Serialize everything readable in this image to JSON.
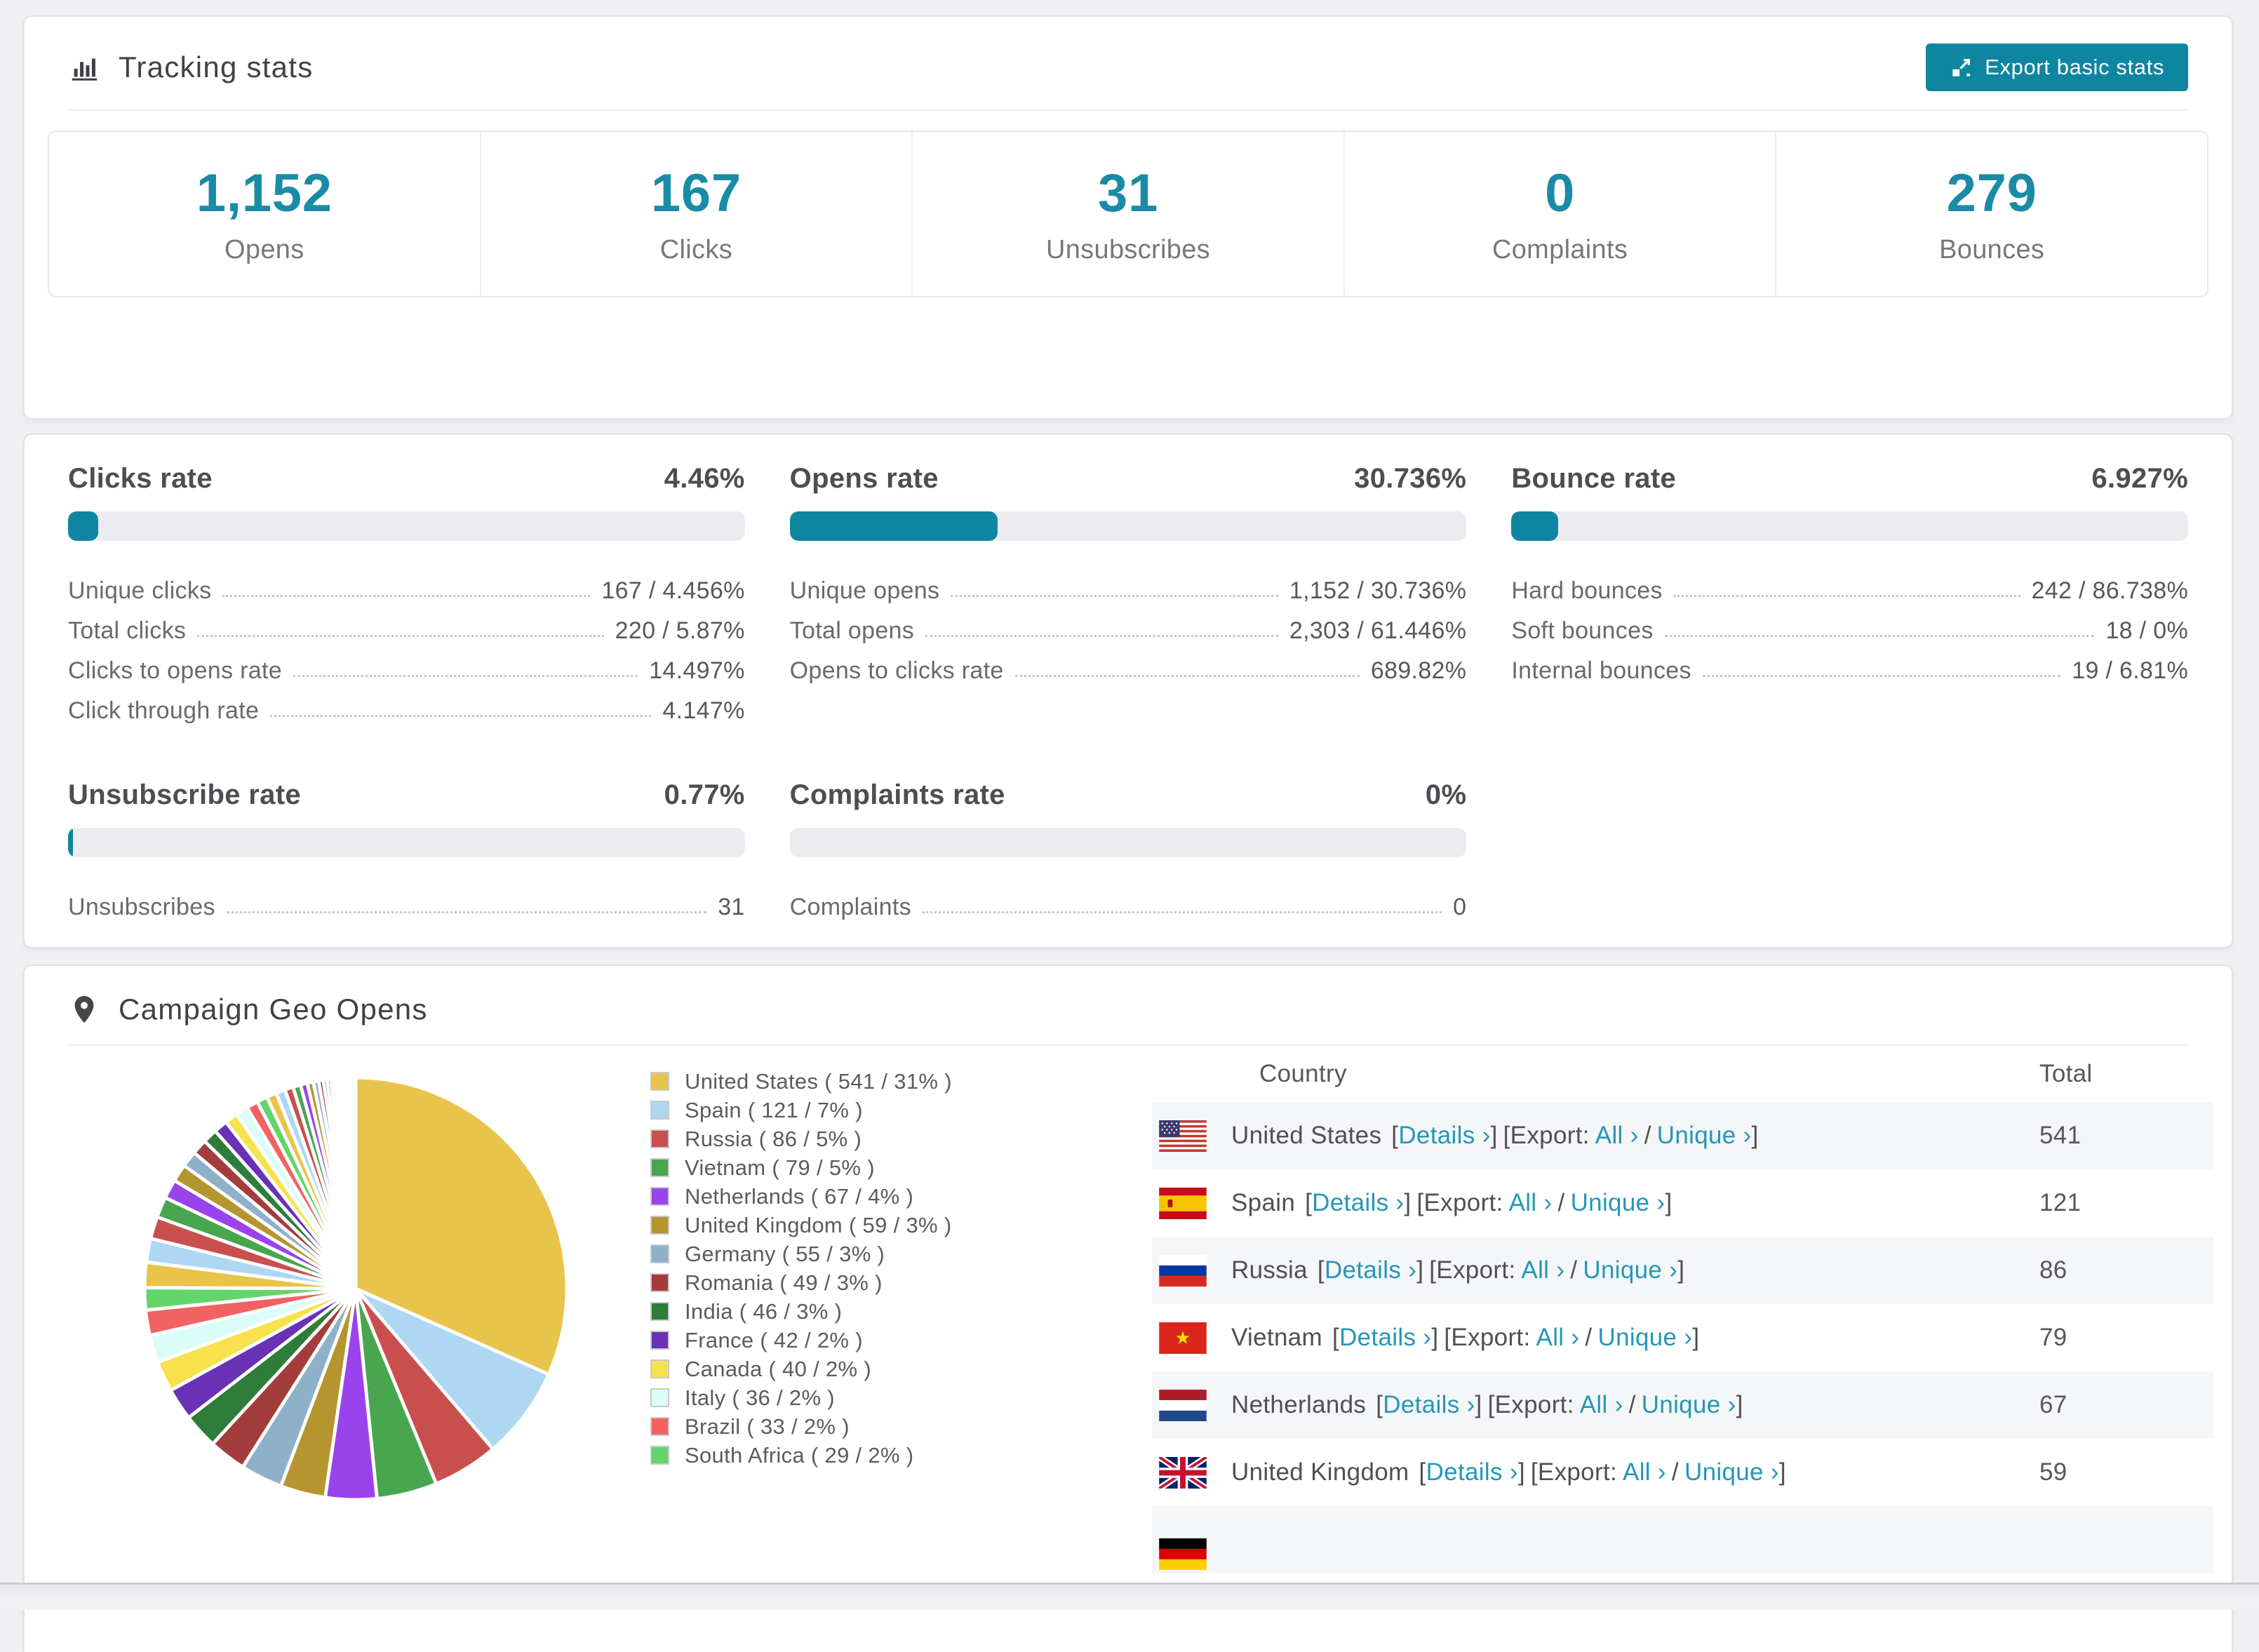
{
  "colors": {
    "accent": "#0e86a1",
    "stat_number": "#1a8ba6",
    "link": "#2497b6",
    "bar_track": "#ececf0",
    "row_alt_bg": "#f5f6f8"
  },
  "tracking": {
    "title": "Tracking stats",
    "export_button": "Export basic stats",
    "stats": [
      {
        "value": "1,152",
        "label": "Opens"
      },
      {
        "value": "167",
        "label": "Clicks"
      },
      {
        "value": "31",
        "label": "Unsubscribes"
      },
      {
        "value": "0",
        "label": "Complaints"
      },
      {
        "value": "279",
        "label": "Bounces"
      }
    ]
  },
  "rates": {
    "clicks": {
      "title": "Clicks rate",
      "value": "4.46%",
      "percent": 4.46,
      "rows": [
        {
          "label": "Unique clicks",
          "value": "167 / 4.456%"
        },
        {
          "label": "Total clicks",
          "value": "220 / 5.87%"
        },
        {
          "label": "Clicks to opens rate",
          "value": "14.497%"
        },
        {
          "label": "Click through rate",
          "value": "4.147%"
        }
      ]
    },
    "opens": {
      "title": "Opens rate",
      "value": "30.736%",
      "percent": 30.736,
      "rows": [
        {
          "label": "Unique opens",
          "value": "1,152 / 30.736%"
        },
        {
          "label": "Total opens",
          "value": "2,303 / 61.446%"
        },
        {
          "label": "Opens to clicks rate",
          "value": "689.82%"
        }
      ]
    },
    "bounce": {
      "title": "Bounce rate",
      "value": "6.927%",
      "percent": 6.927,
      "rows": [
        {
          "label": "Hard bounces",
          "value": "242 / 86.738%"
        },
        {
          "label": "Soft bounces",
          "value": "18 / 0%"
        },
        {
          "label": "Internal bounces",
          "value": "19 / 6.81%"
        }
      ]
    },
    "unsubscribe": {
      "title": "Unsubscribe rate",
      "value": "0.77%",
      "percent": 0.77,
      "rows": [
        {
          "label": "Unsubscribes",
          "value": "31"
        }
      ]
    },
    "complaints": {
      "title": "Complaints rate",
      "value": "0%",
      "percent": 0,
      "rows": [
        {
          "label": "Complaints",
          "value": "0"
        }
      ]
    }
  },
  "geo": {
    "title": "Campaign Geo Opens",
    "legend": [
      {
        "label": "United States ( 541 / 31% )",
        "color": "#e8c44a"
      },
      {
        "label": "Spain ( 121 / 7% )",
        "color": "#aed7f2"
      },
      {
        "label": "Russia ( 86 / 5% )",
        "color": "#c94f4e"
      },
      {
        "label": "Vietnam ( 79 / 5% )",
        "color": "#47a64e"
      },
      {
        "label": "Netherlands ( 67 / 4% )",
        "color": "#9a43ec"
      },
      {
        "label": "United Kingdom ( 59 / 3% )",
        "color": "#b6952f"
      },
      {
        "label": "Germany ( 55 / 3% )",
        "color": "#8fb0c9"
      },
      {
        "label": "Romania ( 49 / 3% )",
        "color": "#a33d3d"
      },
      {
        "label": "India ( 46 / 3% )",
        "color": "#2e7d3a"
      },
      {
        "label": "France ( 42 / 2% )",
        "color": "#6931b5"
      },
      {
        "label": "Canada ( 40 / 2% )",
        "color": "#f7e14d"
      },
      {
        "label": "Italy ( 36 / 2% )",
        "color": "#dcfcf7"
      },
      {
        "label": "Brazil ( 33 / 2% )",
        "color": "#f26262"
      },
      {
        "label": "South Africa ( 29 / 2% )",
        "color": "#63d56b"
      }
    ],
    "table": {
      "headers": {
        "country": "Country",
        "total": "Total"
      },
      "links": {
        "open": "[",
        "details": "Details ›",
        "close": "]",
        "export": "[Export:",
        "all": "All ›",
        "slash": "/",
        "unique": "Unique ›",
        "export_close": "]"
      },
      "rows": [
        {
          "country": "United States",
          "total": "541"
        },
        {
          "country": "Spain",
          "total": "121"
        },
        {
          "country": "Russia",
          "total": "86"
        },
        {
          "country": "Vietnam",
          "total": "79"
        },
        {
          "country": "Netherlands",
          "total": "67"
        },
        {
          "country": "United Kingdom",
          "total": "59"
        },
        {
          "country": "",
          "total": ""
        }
      ]
    }
  },
  "chart_data": {
    "type": "pie",
    "title": "Campaign Geo Opens",
    "legend_position": "right",
    "start_angle_deg": -90,
    "direction": "clockwise",
    "slices": [
      {
        "label": "United States",
        "value": 541,
        "pct": 31,
        "color": "#e8c44a"
      },
      {
        "label": "Spain",
        "value": 121,
        "pct": 7,
        "color": "#aed7f2"
      },
      {
        "label": "Russia",
        "value": 86,
        "pct": 5,
        "color": "#c94f4e"
      },
      {
        "label": "Vietnam",
        "value": 79,
        "pct": 5,
        "color": "#47a64e"
      },
      {
        "label": "Netherlands",
        "value": 67,
        "pct": 4,
        "color": "#9a43ec"
      },
      {
        "label": "United Kingdom",
        "value": 59,
        "pct": 3,
        "color": "#b6952f"
      },
      {
        "label": "Germany",
        "value": 55,
        "pct": 3,
        "color": "#8fb0c9"
      },
      {
        "label": "Romania",
        "value": 49,
        "pct": 3,
        "color": "#a33d3d"
      },
      {
        "label": "India",
        "value": 46,
        "pct": 3,
        "color": "#2e7d3a"
      },
      {
        "label": "France",
        "value": 42,
        "pct": 2,
        "color": "#6931b5"
      },
      {
        "label": "Canada",
        "value": 40,
        "pct": 2,
        "color": "#f7e14d"
      },
      {
        "label": "Italy",
        "value": 36,
        "pct": 2,
        "color": "#dcfcf7"
      },
      {
        "label": "Brazil",
        "value": 33,
        "pct": 2,
        "color": "#f26262"
      },
      {
        "label": "South Africa",
        "value": 29,
        "pct": 2,
        "color": "#63d56b"
      }
    ],
    "other_values": [
      33,
      31,
      29,
      27,
      25,
      23,
      21,
      20,
      19,
      18,
      17,
      16,
      15,
      14,
      13,
      12,
      11,
      10,
      9,
      8,
      7,
      6,
      5,
      5,
      4,
      4,
      3,
      3,
      3,
      2,
      2,
      2,
      2,
      1,
      1,
      1,
      1,
      1,
      1,
      1
    ]
  }
}
